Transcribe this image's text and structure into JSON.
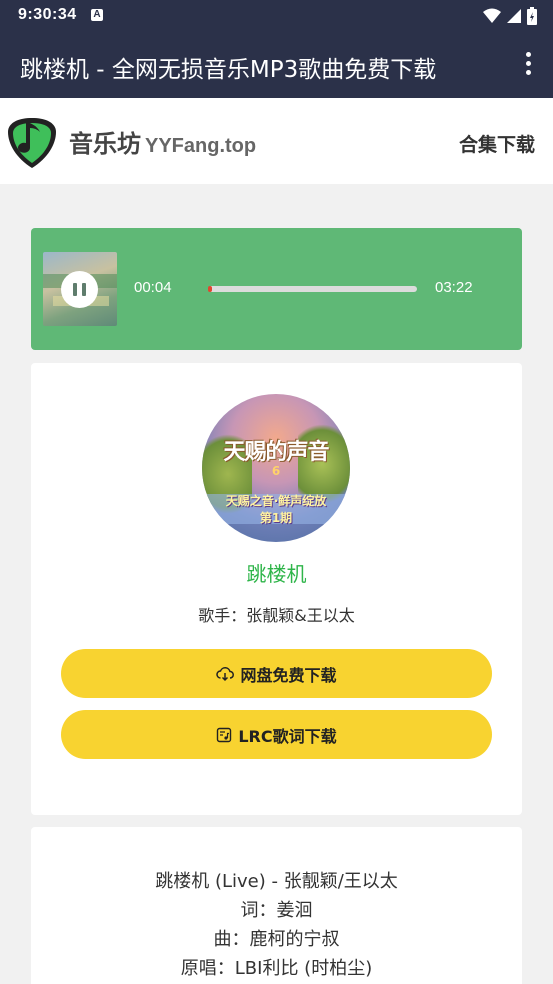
{
  "status_bar": {
    "time": "9:30:34",
    "notification_icon": "a-icon"
  },
  "app_bar": {
    "title": "跳楼机 - 全网无损音乐MP3歌曲免费下载"
  },
  "site": {
    "name": "音乐坊",
    "domain": "YYFang.top",
    "collection_link": "合集下载"
  },
  "player": {
    "current_time": "00:04",
    "total_time": "03:22",
    "progress": 0.02,
    "state": "playing"
  },
  "song": {
    "title": "跳楼机",
    "artist_line": "歌手：张靓颖&王以太",
    "album_art_text": {
      "title": "天赐的声音",
      "number": "6",
      "subtitle": "天赐之音·鲜声绽放",
      "episode": "第1期"
    },
    "netdisk_button": "网盘免费下载",
    "lrc_button": "LRC歌词下载"
  },
  "lyrics": {
    "lines": [
      "跳楼机 (Live) - 张靓颖/王以太",
      "词：姜洄",
      "曲：鹿柯的宁叔",
      "原唱：LBI利比 (时柏尘)"
    ]
  },
  "colors": {
    "app_bar": "#2b3149",
    "player_bg": "#5fb876",
    "accent_green": "#2fb54a",
    "button_yellow": "#f8d330",
    "progress_red": "#e0472e"
  }
}
